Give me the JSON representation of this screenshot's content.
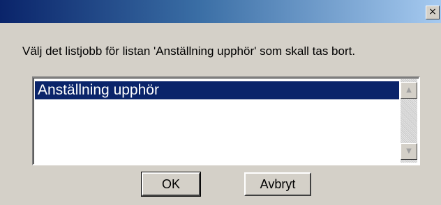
{
  "window": {
    "title": "",
    "close_glyph": "×",
    "close_icon": "close-icon"
  },
  "dialog": {
    "message": "Välj det listjobb för listan 'Anställning upphör' som skall tas bort."
  },
  "listbox": {
    "items": [
      {
        "label": "Anställning upphör",
        "selected": true
      }
    ],
    "scroll_up_glyph": "▲",
    "scroll_down_glyph": "▼"
  },
  "buttons": {
    "ok_label": "OK",
    "cancel_label": "Avbryt"
  },
  "colors": {
    "selection": "#0a246a",
    "face": "#d4d0c8"
  }
}
